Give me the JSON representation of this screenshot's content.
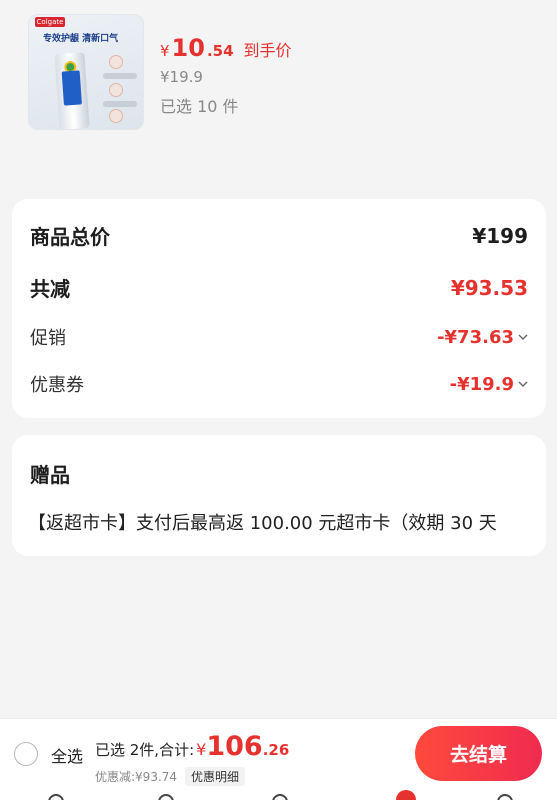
{
  "product": {
    "brand_logo": "Colgate",
    "image_headline": "专效护龈 清新口气",
    "price_currency": "¥",
    "price_int": "10",
    "price_dec": ".54",
    "price_tag": "到手价",
    "original_price": "¥19.9",
    "selected_count": "已选 10 件"
  },
  "summary": {
    "total_label": "商品总价",
    "total_value": "¥199",
    "reduction_label": "共减",
    "reduction_value": "¥93.53",
    "promo_label": "促销",
    "promo_value": "-¥73.63",
    "coupon_label": "优惠券",
    "coupon_value": "-¥19.9"
  },
  "gift": {
    "title": "赠品",
    "description": "【返超市卡】支付后最高返 100.00 元超市卡（效期 30 天"
  },
  "checkout": {
    "select_all_label": "全选",
    "total_prefix": "已选 2件,合计:",
    "total_currency": "¥",
    "total_int": "106",
    "total_dec": ".26",
    "discount_text": "优惠减:¥93.74",
    "detail_label": "优惠明细",
    "pay_label": "去结算"
  },
  "colors": {
    "accent_red": "#e6322e",
    "button_gradient_start": "#ff4a3d",
    "button_gradient_end": "#f02b4f"
  },
  "icons": [
    "chevron-down-icon",
    "radio-unchecked-icon"
  ]
}
